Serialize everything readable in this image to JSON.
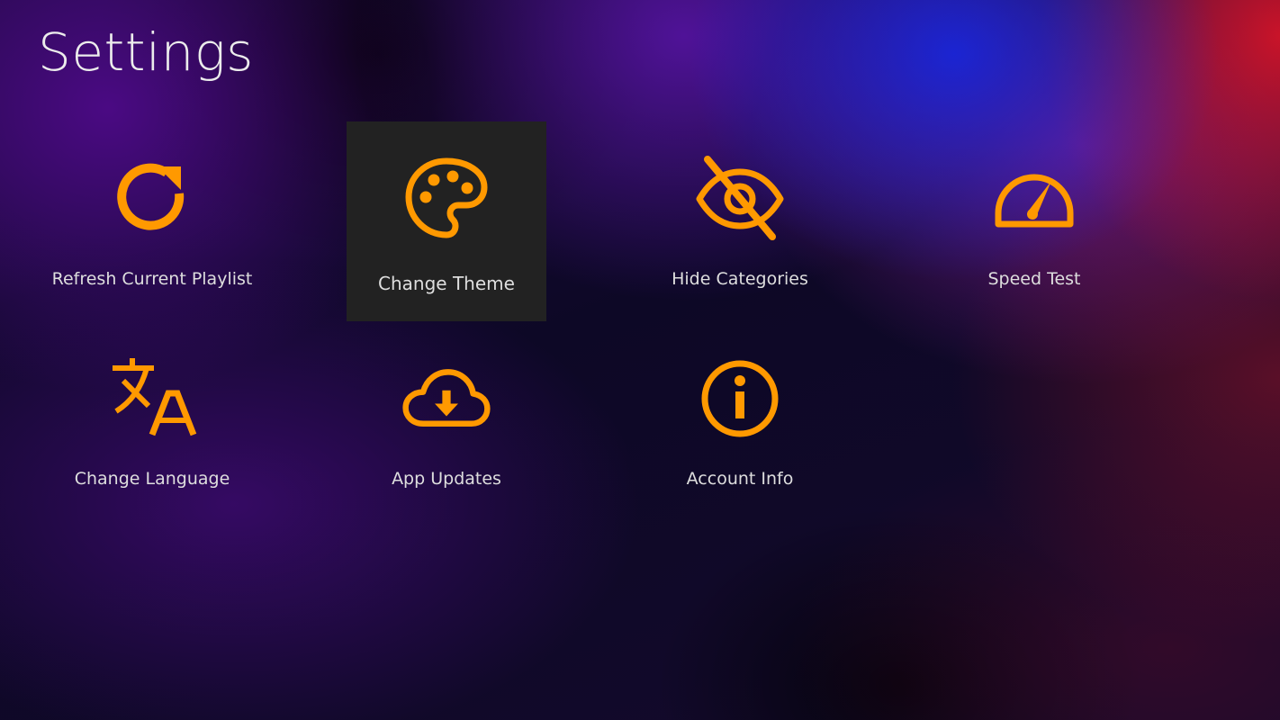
{
  "page": {
    "title": "Settings"
  },
  "colors": {
    "accent": "#ff9900",
    "selected_tile_bg": "#222222",
    "label_text": "#dedede"
  },
  "settings_items": [
    {
      "label": "Refresh Current Playlist",
      "icon": "refresh-icon",
      "selected": false
    },
    {
      "label": "Change Theme",
      "icon": "palette-icon",
      "selected": true
    },
    {
      "label": "Hide Categories",
      "icon": "eye-off-icon",
      "selected": false
    },
    {
      "label": "Speed Test",
      "icon": "speedometer-icon",
      "selected": false
    },
    {
      "label": "Change Language",
      "icon": "translate-icon",
      "selected": false
    },
    {
      "label": "App Updates",
      "icon": "cloud-download-icon",
      "selected": false
    },
    {
      "label": "Account Info",
      "icon": "info-icon",
      "selected": false
    }
  ]
}
